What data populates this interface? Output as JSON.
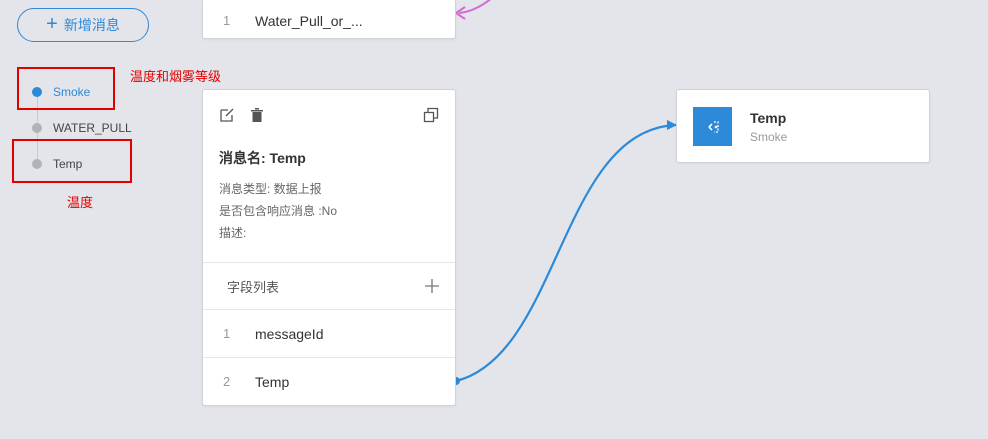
{
  "toolbar": {
    "add_message_label": "新增消息"
  },
  "messages": [
    {
      "label": "Smoke",
      "active": true
    },
    {
      "label": "WATER_PULL",
      "active": false
    },
    {
      "label": "Temp",
      "active": false
    }
  ],
  "annotations": {
    "smoke_note": "温度和烟雾等级",
    "temp_note": "温度"
  },
  "top_card": {
    "index": "1",
    "name": "Water_Pull_or_..."
  },
  "message_card": {
    "title": "消息名: Temp",
    "type_line": "消息类型: 数据上报",
    "response_line": "是否包含响应消息 :No",
    "desc_line": "描述:",
    "fields_header": "字段列表",
    "fields": [
      {
        "index": "1",
        "name": "messageId"
      },
      {
        "index": "2",
        "name": "Temp"
      }
    ]
  },
  "target_card": {
    "title": "Temp",
    "subtitle": "Smoke"
  },
  "colors": {
    "accent": "#2d8ad8",
    "annotation": "#e00000",
    "link_magenta": "#d46ad6"
  }
}
